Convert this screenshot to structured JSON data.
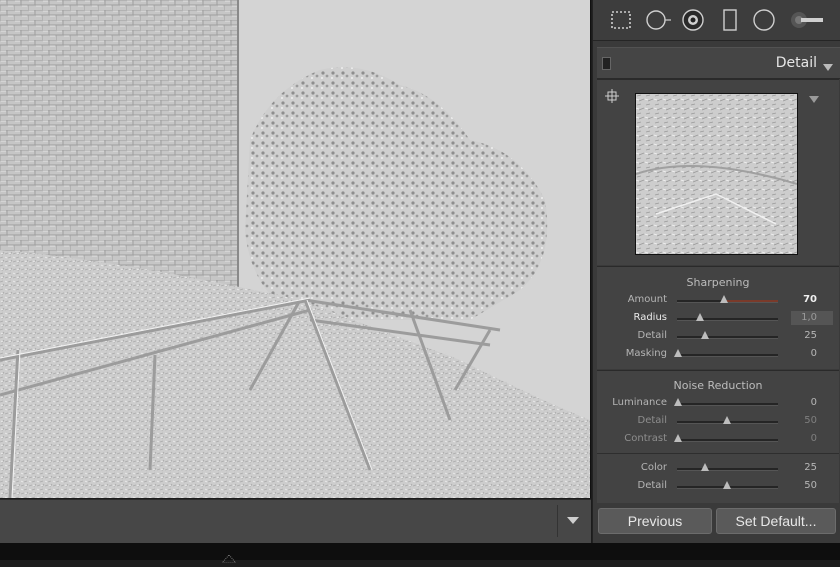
{
  "panel": {
    "title": "Detail",
    "sharpening": {
      "title": "Sharpening",
      "sliders": [
        {
          "label": "Amount",
          "value": "70",
          "fraction": 0.47
        },
        {
          "label": "Radius",
          "value": "1,0",
          "fraction": 0.23
        },
        {
          "label": "Detail",
          "value": "25",
          "fraction": 0.28
        },
        {
          "label": "Masking",
          "value": "0",
          "fraction": 0.0
        }
      ]
    },
    "noise": {
      "title": "Noise Reduction",
      "sliders": [
        {
          "label": "Luminance",
          "value": "0",
          "fraction": 0.0
        },
        {
          "label": "Detail",
          "value": "50",
          "fraction": 0.5
        },
        {
          "label": "Contrast",
          "value": "0",
          "fraction": 0.0
        },
        {
          "label": "Color",
          "value": "25",
          "fraction": 0.28
        },
        {
          "label": "Detail",
          "value": "50",
          "fraction": 0.5
        }
      ]
    }
  },
  "buttons": {
    "previous": "Previous",
    "set_default": "Set Default..."
  },
  "colors": {
    "panel": "#3a3a3a",
    "accent_fill": "#7a3a2a",
    "photo": "#cfcfcf"
  },
  "icons": [
    "crop-overlay-icon",
    "spot-removal-icon",
    "red-eye-icon",
    "graduated-filter-icon",
    "radial-filter-icon",
    "adjustment-brush-icon",
    "crosshair-icon",
    "collapse-triangle-icon",
    "filmstrip-toggle-icon"
  ]
}
